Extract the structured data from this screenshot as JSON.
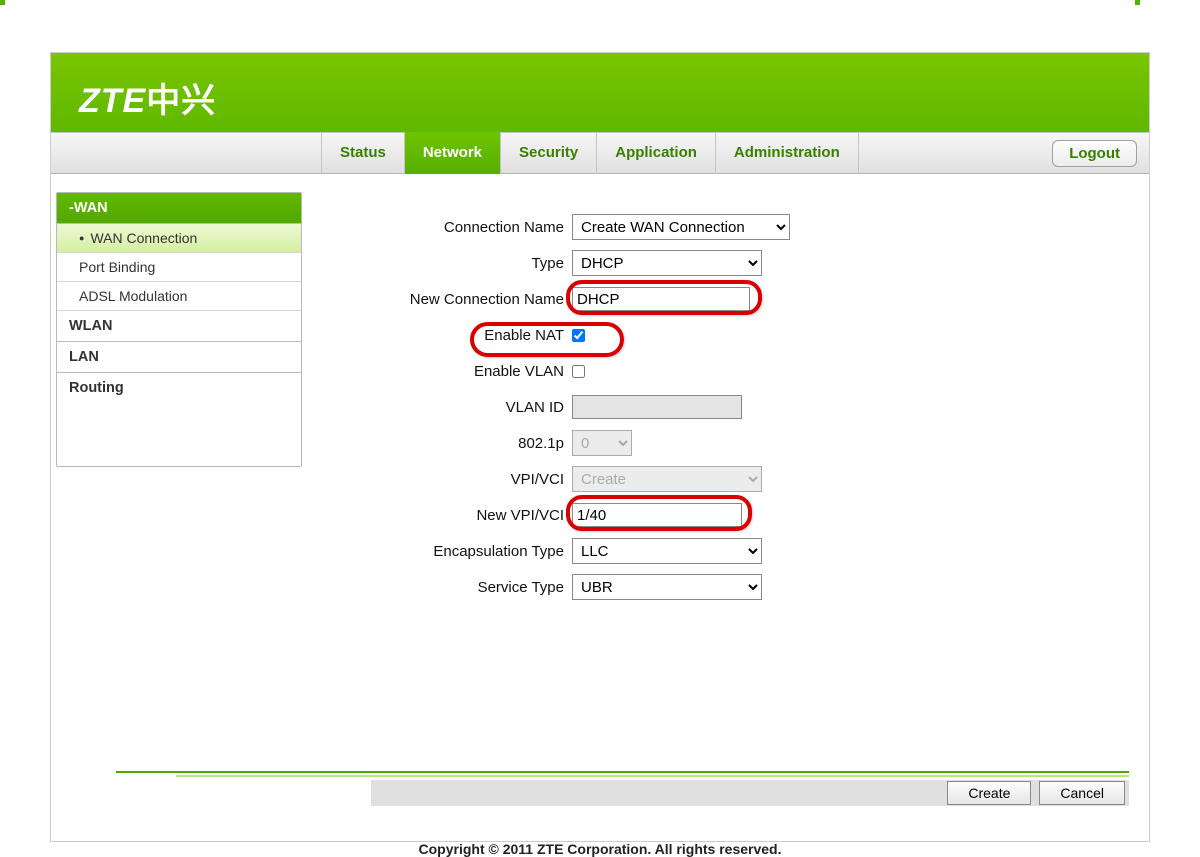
{
  "brand": {
    "logo_en": "ZTE",
    "logo_cn": "中兴"
  },
  "tabs": {
    "status": "Status",
    "network": "Network",
    "security": "Security",
    "application": "Application",
    "administration": "Administration"
  },
  "logout": "Logout",
  "sidebar": {
    "wan": "-WAN",
    "wanconn": "WAN Connection",
    "portbinding": "Port Binding",
    "adsl": "ADSL Modulation",
    "wlan": "WLAN",
    "lan": "LAN",
    "routing": "Routing"
  },
  "form": {
    "connection_name_label": "Connection Name",
    "connection_name_value": "Create WAN Connection",
    "type_label": "Type",
    "type_value": "DHCP",
    "new_conn_label": "New Connection Name",
    "new_conn_value": "DHCP",
    "enable_nat_label": "Enable NAT",
    "enable_vlan_label": "Enable VLAN",
    "vlan_id_label": "VLAN ID",
    "p8021_label": "802.1p",
    "p8021_value": "0",
    "vpivci_label": "VPI/VCI",
    "vpivci_value": "Create",
    "new_vpivci_label": "New VPI/VCI",
    "new_vpivci_value": "1/40",
    "encap_label": "Encapsulation Type",
    "encap_value": "LLC",
    "service_label": "Service Type",
    "service_value": "UBR"
  },
  "buttons": {
    "create": "Create",
    "cancel": "Cancel"
  },
  "copyright": "Copyright © 2011 ZTE Corporation. All rights reserved."
}
